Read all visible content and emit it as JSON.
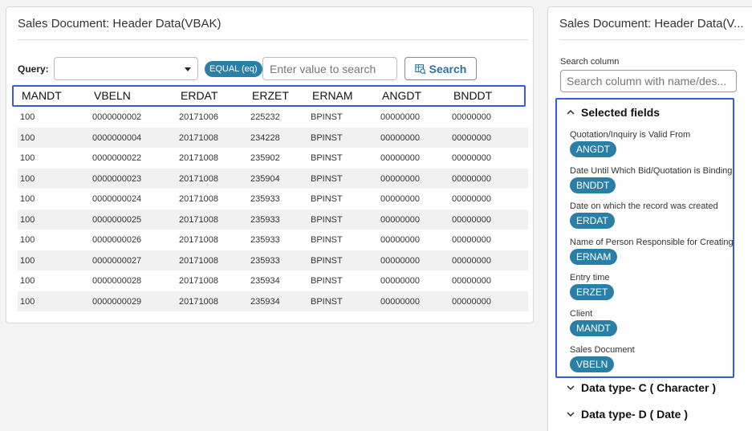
{
  "left_panel": {
    "title": "Sales Document: Header Data(VBAK)",
    "query_label": "Query:",
    "query_select_value": "",
    "operator_chip": "EQUAL (eq)",
    "value_placeholder": "Enter value to search",
    "search_label": "Search",
    "columns": [
      "MANDT",
      "VBELN",
      "ERDAT",
      "ERZET",
      "ERNAM",
      "ANGDT",
      "BNDDT"
    ],
    "rows": [
      [
        "100",
        "0000000002",
        "20171006",
        "225232",
        "BPINST",
        "00000000",
        "00000000"
      ],
      [
        "100",
        "0000000004",
        "20171008",
        "234228",
        "BPINST",
        "00000000",
        "00000000"
      ],
      [
        "100",
        "0000000022",
        "20171008",
        "235902",
        "BPINST",
        "00000000",
        "00000000"
      ],
      [
        "100",
        "0000000023",
        "20171008",
        "235904",
        "BPINST",
        "00000000",
        "00000000"
      ],
      [
        "100",
        "0000000024",
        "20171008",
        "235933",
        "BPINST",
        "00000000",
        "00000000"
      ],
      [
        "100",
        "0000000025",
        "20171008",
        "235933",
        "BPINST",
        "00000000",
        "00000000"
      ],
      [
        "100",
        "0000000026",
        "20171008",
        "235933",
        "BPINST",
        "00000000",
        "00000000"
      ],
      [
        "100",
        "0000000027",
        "20171008",
        "235933",
        "BPINST",
        "00000000",
        "00000000"
      ],
      [
        "100",
        "0000000028",
        "20171008",
        "235934",
        "BPINST",
        "00000000",
        "00000000"
      ],
      [
        "100",
        "0000000029",
        "20171008",
        "235934",
        "BPINST",
        "00000000",
        "00000000"
      ]
    ]
  },
  "right_panel": {
    "title": "Sales Document: Header Data(V...",
    "search_column_label": "Search column",
    "search_column_placeholder": "Search column with name/des...",
    "selected_fields_label": "Selected fields",
    "selected_fields": [
      {
        "desc": "Quotation/Inquiry is Valid From",
        "code": "ANGDT"
      },
      {
        "desc": "Date Until Which Bid/Quotation is Binding (Valid-To Date)",
        "code": "BNDDT"
      },
      {
        "desc": "Date on which the record was created",
        "code": "ERDAT"
      },
      {
        "desc": "Name of Person Responsible for Creating the Object",
        "code": "ERNAM"
      },
      {
        "desc": "Entry time",
        "code": "ERZET"
      },
      {
        "desc": "Client",
        "code": "MANDT"
      },
      {
        "desc": "Sales Document",
        "code": "VBELN"
      }
    ],
    "data_type_c": "Data type- C ( Character )",
    "data_type_d": "Data type- D ( Date )"
  },
  "colors": {
    "accent": "#2a7fa6",
    "highlight_border": "#3a5bd9"
  }
}
